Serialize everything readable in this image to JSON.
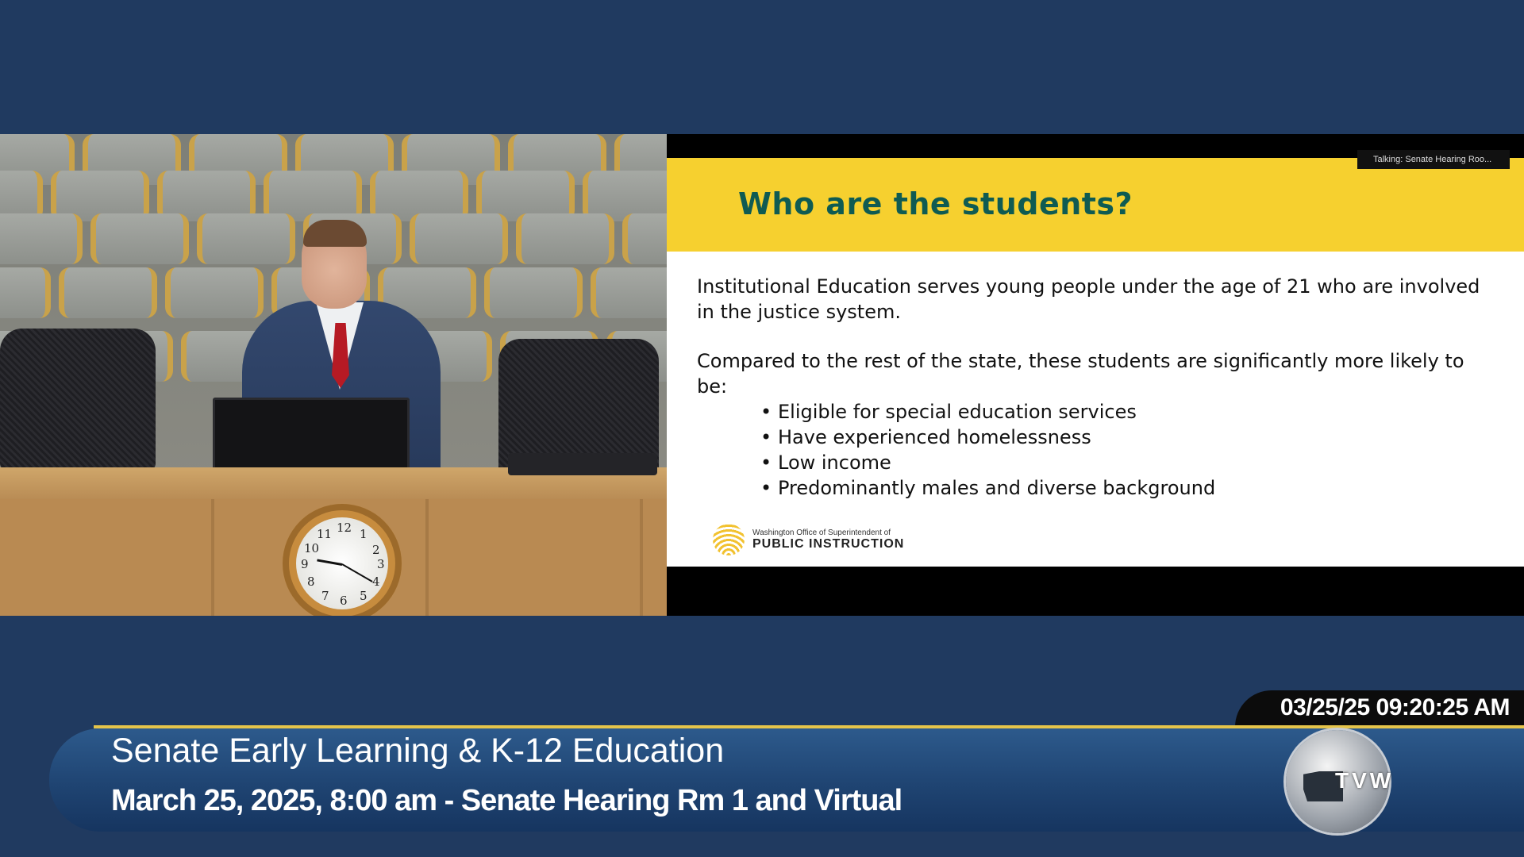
{
  "slide": {
    "talking_tag": "Talking: Senate Hearing Roo...",
    "title": "Who are the students?",
    "paragraph1": "Institutional Education serves young people under the age of 21 who are involved in the justice system.",
    "paragraph2": "Compared to the rest of the state, these students are significantly more likely to be:",
    "bullets": [
      "Eligible for special education services",
      "Have experienced homelessness",
      "Low income",
      "Predominantly males and diverse background"
    ],
    "logo": {
      "small_text": "Washington Office of Superintendent of",
      "big_text": "PUBLIC INSTRUCTION"
    }
  },
  "clock_numbers": [
    "12",
    "1",
    "2",
    "3",
    "4",
    "5",
    "6",
    "7",
    "8",
    "9",
    "10",
    "11"
  ],
  "lower_third": {
    "timestamp": "03/25/25 09:20:25 AM",
    "title": "Senate Early Learning & K-12 Education",
    "subtitle": "March 25, 2025, 8:00 am - Senate Hearing Rm 1 and Virtual",
    "logo_text": "TVW"
  },
  "colors": {
    "background": "#203a60",
    "slide_header": "#f6d02f",
    "slide_title": "#0f5b52",
    "rule": "#e5c44a"
  }
}
